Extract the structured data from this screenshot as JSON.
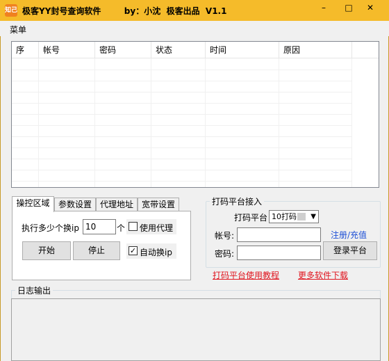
{
  "window": {
    "title": "极客YY封号查询软件        by：小沈  极客出品  V1.1",
    "icon_text": "知己",
    "minimize": "–",
    "maximize": "□",
    "close": "✕"
  },
  "menu": {
    "items": [
      "菜单"
    ]
  },
  "list": {
    "columns": [
      "序",
      "帐号",
      "密码",
      "状态",
      "时间",
      "原因"
    ],
    "rows": []
  },
  "tabs": {
    "items": [
      "操控区域",
      "参数设置",
      "代理地址",
      "宽带设置"
    ],
    "active_index": 0
  },
  "control": {
    "switch_label": "执行多少个换ip",
    "switch_value": "10",
    "unit": "个",
    "use_proxy_label": "使用代理",
    "use_proxy_checked": false,
    "start_button": "开始",
    "stop_button": "停止",
    "auto_ip_label": "自动换ip",
    "auto_ip_checked": true
  },
  "captcha": {
    "group_title": "打码平台接入",
    "platform_label": "打码平台",
    "platform_value": "10打码",
    "account_label": "帐号:",
    "account_value": "",
    "password_label": "密码:",
    "password_value": "",
    "register_link": "注册/充值",
    "login_button": "登录平台"
  },
  "links": {
    "tutorial": "打码平台使用教程",
    "more_software": "更多软件下载"
  },
  "log": {
    "title": "日志输出"
  },
  "colors": {
    "titlebar": "#f5bb2a",
    "link_blue": "#1c4fd6",
    "link_red": "#e0141e"
  }
}
